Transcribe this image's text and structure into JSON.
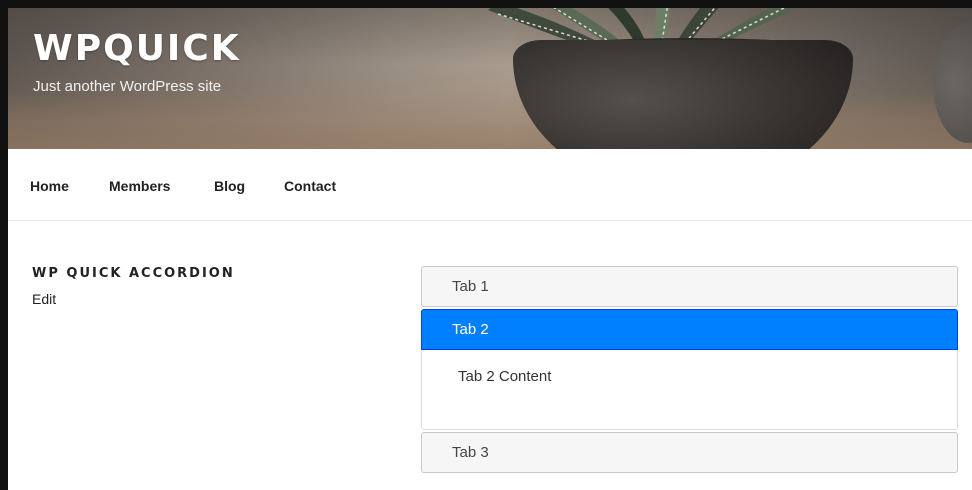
{
  "site": {
    "title": "WPQUICK",
    "tagline": "Just another WordPress site"
  },
  "nav": {
    "items": [
      {
        "label": "Home"
      },
      {
        "label": "Members"
      },
      {
        "label": "Blog"
      },
      {
        "label": "Contact"
      }
    ]
  },
  "page": {
    "title": "WP QUICK ACCORDION",
    "edit_label": "Edit"
  },
  "accordion": {
    "tabs": [
      {
        "label": "Tab 1",
        "expanded": false
      },
      {
        "label": "Tab 2",
        "expanded": true,
        "content": "Tab 2 Content"
      },
      {
        "label": "Tab 3",
        "expanded": false
      }
    ],
    "active_color": "#007fff",
    "tab_color": "#f6f6f6"
  }
}
